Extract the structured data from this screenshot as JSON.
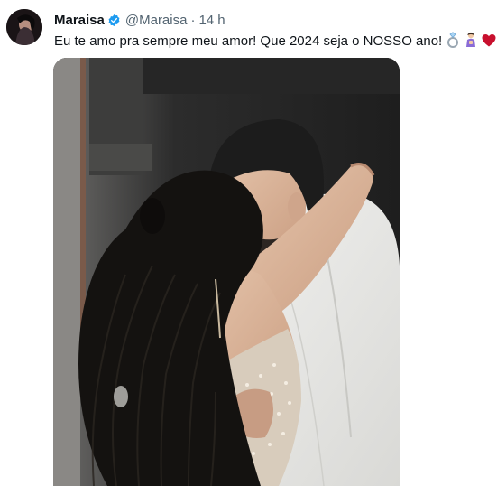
{
  "tweet": {
    "author_name": "Maraisa",
    "author_handle": "@Maraisa",
    "separator": "·",
    "timestamp": "14 h",
    "verified": true,
    "text": "Eu te amo pra sempre meu amor! Que 2024 seja o NOSSO ano!",
    "emojis": [
      "ring-icon",
      "couple-icon",
      "red-heart-icon"
    ]
  },
  "colors": {
    "verified_blue": "#1d9bf0",
    "secondary_text": "#536471",
    "heart_red": "#c8102e"
  }
}
